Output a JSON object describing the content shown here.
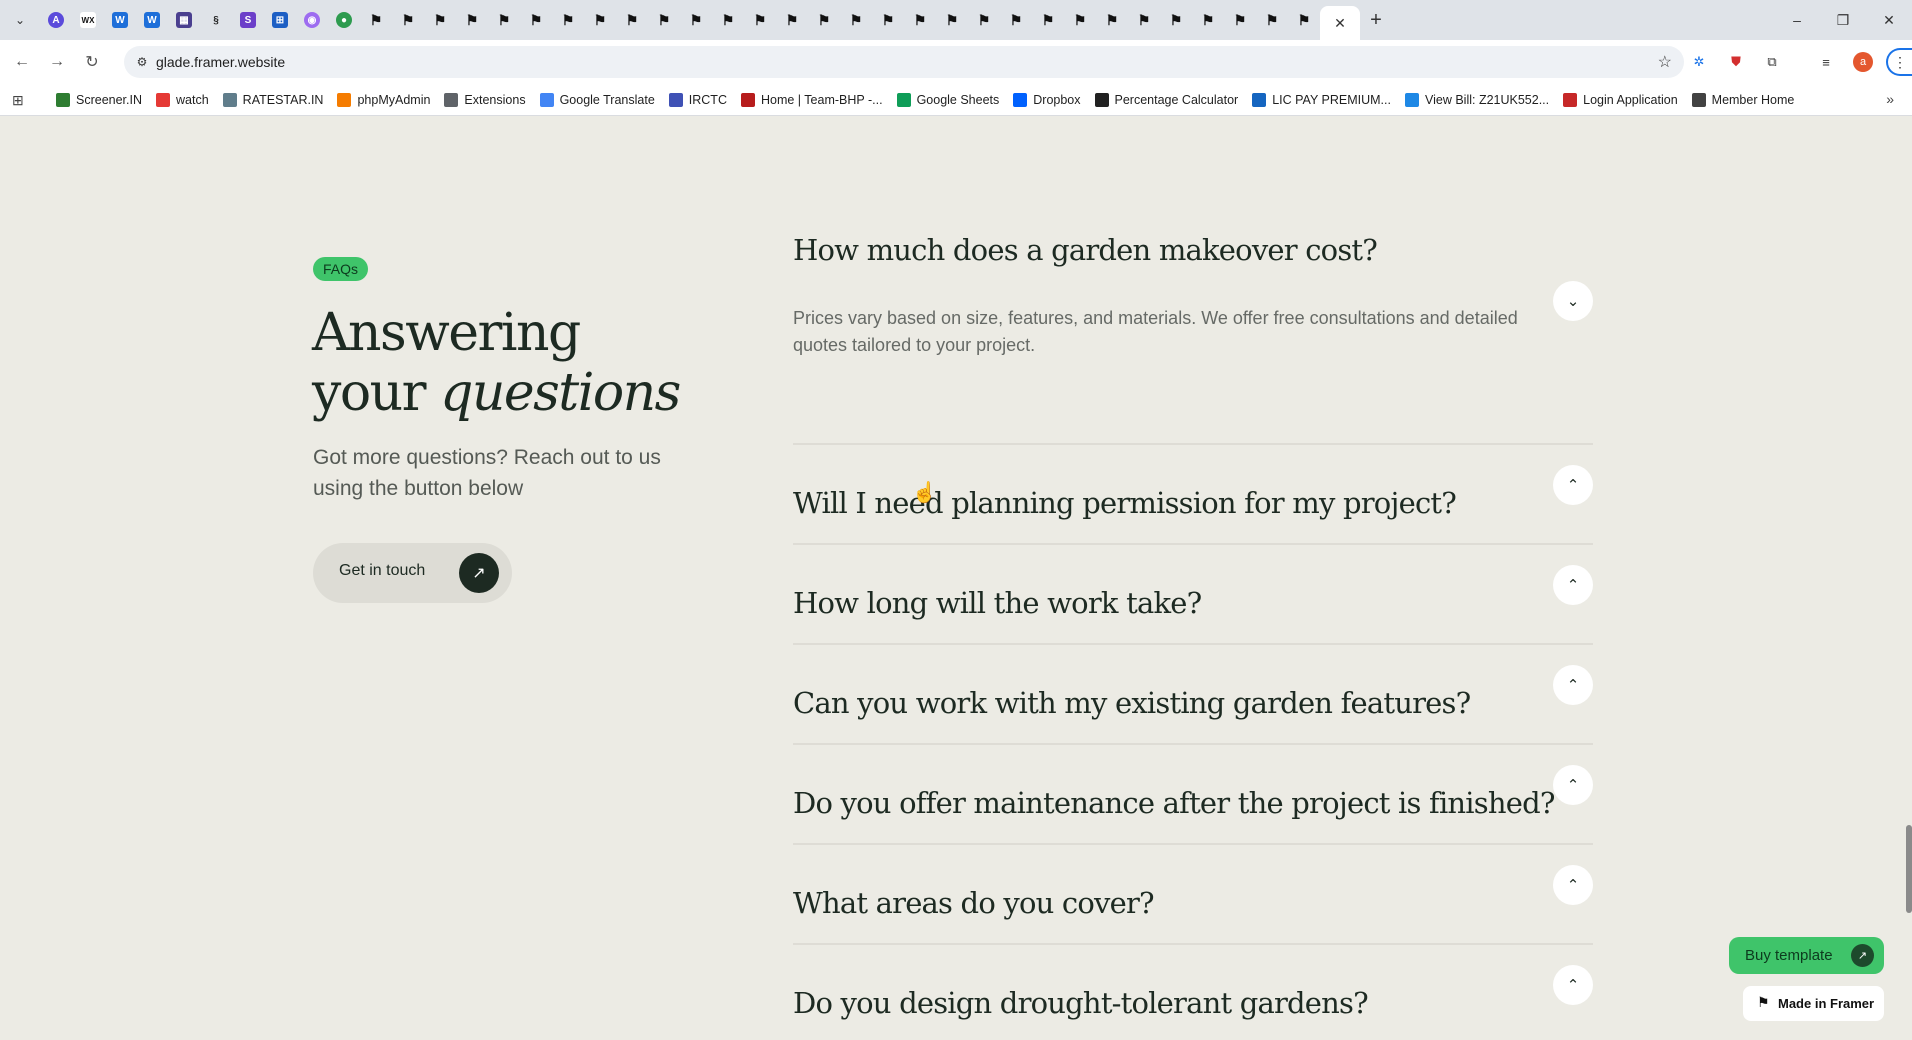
{
  "browser": {
    "url": "glade.framer.website",
    "tabs_menu_icon": "chevron-down-icon",
    "new_tab_label": "+",
    "active_tab_close": "✕",
    "bookmarks": [
      {
        "label": "Screener.IN",
        "color": "#2e7d32"
      },
      {
        "label": "watch",
        "color": "#e53935"
      },
      {
        "label": "RATESTAR.IN",
        "color": "#607d8b"
      },
      {
        "label": "phpMyAdmin",
        "color": "#f57c00"
      },
      {
        "label": "Extensions",
        "color": "#5f6368"
      },
      {
        "label": "Google Translate",
        "color": "#4285f4"
      },
      {
        "label": "IRCTC",
        "color": "#3f51b5"
      },
      {
        "label": "Home | Team-BHP -...",
        "color": "#b71c1c"
      },
      {
        "label": "Google Sheets",
        "color": "#0f9d58"
      },
      {
        "label": "Dropbox",
        "color": "#0061fe"
      },
      {
        "label": "Percentage Calculator",
        "color": "#212121"
      },
      {
        "label": "LIC PAY PREMIUM...",
        "color": "#1565c0"
      },
      {
        "label": "View Bill: Z21UK552...",
        "color": "#1e88e5"
      },
      {
        "label": "Login Application",
        "color": "#c62828"
      },
      {
        "label": "Member Home",
        "color": "#424242"
      }
    ]
  },
  "faq_section": {
    "badge": "FAQs",
    "heading_line1": "Answering",
    "heading_line2_plain": "your ",
    "heading_line2_italic": "questions",
    "subtext": "Got more questions? Reach out to us using the button below",
    "cta_label": "Get in touch",
    "cta_icon": "arrow-up-right-icon",
    "items": [
      {
        "question": "How much does a garden makeover cost?",
        "answer": "Prices vary based on size, features, and materials. We offer free consultations and detailed quotes tailored to your project.",
        "expanded": true
      },
      {
        "question": "Will I need planning permission for my project?",
        "expanded": false
      },
      {
        "question": "How long will the work take?",
        "expanded": false
      },
      {
        "question": "Can you work with my existing garden features?",
        "expanded": false
      },
      {
        "question": "Do you offer maintenance after the project is finished?",
        "expanded": false
      },
      {
        "question": "What areas do you cover?",
        "expanded": false
      },
      {
        "question": "Do you design drought-tolerant gardens?",
        "expanded": false
      }
    ]
  },
  "floating": {
    "buy_label": "Buy template",
    "made_in_label": "Made in Framer"
  },
  "colors": {
    "page_bg": "#ecebe4",
    "accent_green": "#3fc46a",
    "text_dark": "#1d2a22"
  }
}
